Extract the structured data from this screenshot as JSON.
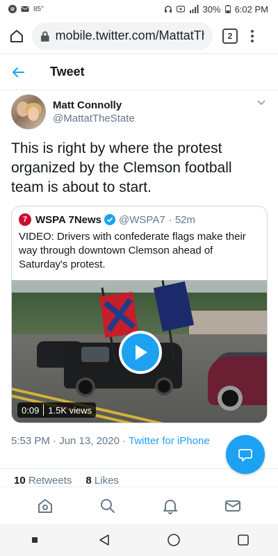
{
  "status_bar": {
    "temperature": "85°",
    "battery": "30%",
    "time": "6:02 PM"
  },
  "browser": {
    "url": "mobile.twitter.com/MattatTh",
    "tab_count": "2"
  },
  "header": {
    "title": "Tweet"
  },
  "author": {
    "name": "Matt Connolly",
    "handle": "@MattatTheState"
  },
  "tweet": {
    "text": "This is right by where the protest organized by the Clemson football team is about to start.",
    "timestamp": "5:53 PM · Jun 13, 2020 ·",
    "client": "Twitter for iPhone",
    "retweets_count": "10",
    "retweets_label": "Retweets",
    "likes_count": "8",
    "likes_label": "Likes"
  },
  "quoted": {
    "logo_text": "7",
    "name": "WSPA 7News",
    "handle": "@WSPA7",
    "time": "· 52m",
    "text": "VIDEO: Drivers with confederate flags make their way through downtown Clemson ahead of Saturday's protest.",
    "video_duration": "0:09",
    "video_views": "1.5K views"
  },
  "colors": {
    "accent": "#1da1f2",
    "muted": "#657786",
    "brand_red": "#c8102e"
  },
  "icons": {
    "home": "home-icon",
    "search": "search-icon",
    "notifications": "bell-icon",
    "messages": "mail-icon",
    "compose": "chat-bubble-icon"
  }
}
